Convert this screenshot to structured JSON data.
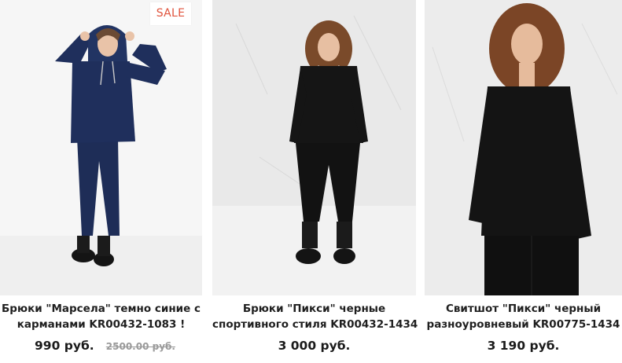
{
  "products": [
    {
      "badge": "SALE",
      "image": "model-in-navy-hoodie-and-pants",
      "title_line1": "Брюки \"Марсела\" темно синие с",
      "title_line2": "карманами KR00432-1083 !",
      "price": "990 руб.",
      "old_price": "2500.00 руб."
    },
    {
      "image": "model-in-black-sweatshirt-and-joggers",
      "title_line1": "Брюки \"Пикси\" черные",
      "title_line2": "спортивного стиля KR00432-1434",
      "price": "3 000 руб."
    },
    {
      "image": "model-in-black-sweatshirt-closeup",
      "title_line1": "Свитшот \"Пикси\" черный",
      "title_line2": "разноуровневый KR00775-1434",
      "price": "3 190 руб."
    }
  ],
  "colors": {
    "sale_badge_text": "#e0533c",
    "old_price": "#9a9a9a",
    "navy_outfit": "#1e2d57",
    "black_outfit": "#151515"
  }
}
